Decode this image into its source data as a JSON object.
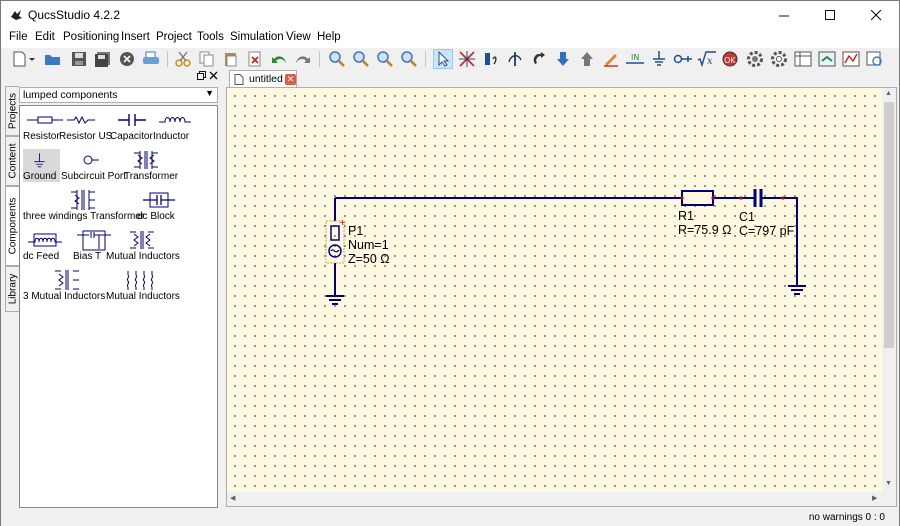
{
  "window": {
    "title": "QucsStudio 4.2.2"
  },
  "menu": [
    "File",
    "Edit",
    "Positioning",
    "Insert",
    "Project",
    "Tools",
    "Simulation",
    "View",
    "Help"
  ],
  "dock": {
    "side_tabs": [
      "Projects",
      "Content",
      "Components",
      "Library"
    ],
    "category": "lumped components",
    "components": [
      {
        "label": "Resistor",
        "icon": "resistor-icon"
      },
      {
        "label": "Resistor US",
        "icon": "resistor-us-icon"
      },
      {
        "label": "Capacitor",
        "icon": "capacitor-icon"
      },
      {
        "label": "Inductor",
        "icon": "inductor-icon"
      },
      {
        "label": "Ground",
        "icon": "ground-icon",
        "selected": true
      },
      {
        "label": "Subcircuit Port",
        "icon": "subcircuit-port-icon"
      },
      {
        "label": "Transformer",
        "icon": "transformer-icon"
      },
      {
        "label": "three windings Transformer",
        "icon": "three-windings-transformer-icon"
      },
      {
        "label": "dc Block",
        "icon": "dc-block-icon"
      },
      {
        "label": "dc Feed",
        "icon": "dc-feed-icon"
      },
      {
        "label": "Bias T",
        "icon": "bias-t-icon"
      },
      {
        "label": "Mutual Inductors",
        "icon": "mutual-inductors-icon"
      },
      {
        "label": "3 Mutual Inductors",
        "icon": "three-mutual-inductors-icon"
      },
      {
        "label": "Mutual Inductors",
        "icon": "mutual-inductors-multi-icon"
      }
    ]
  },
  "document": {
    "tab_label": "untitled"
  },
  "schematic": {
    "wire_color": "#00007f",
    "P1": {
      "name": "P1",
      "num": "Num=1",
      "z": "Z=50 Ω"
    },
    "R1": {
      "name": "R1",
      "value": "R=75.9 Ω"
    },
    "C1": {
      "name": "C1",
      "value": "C=797 pF"
    }
  },
  "status": {
    "message": "no warnings 0 : 0"
  }
}
